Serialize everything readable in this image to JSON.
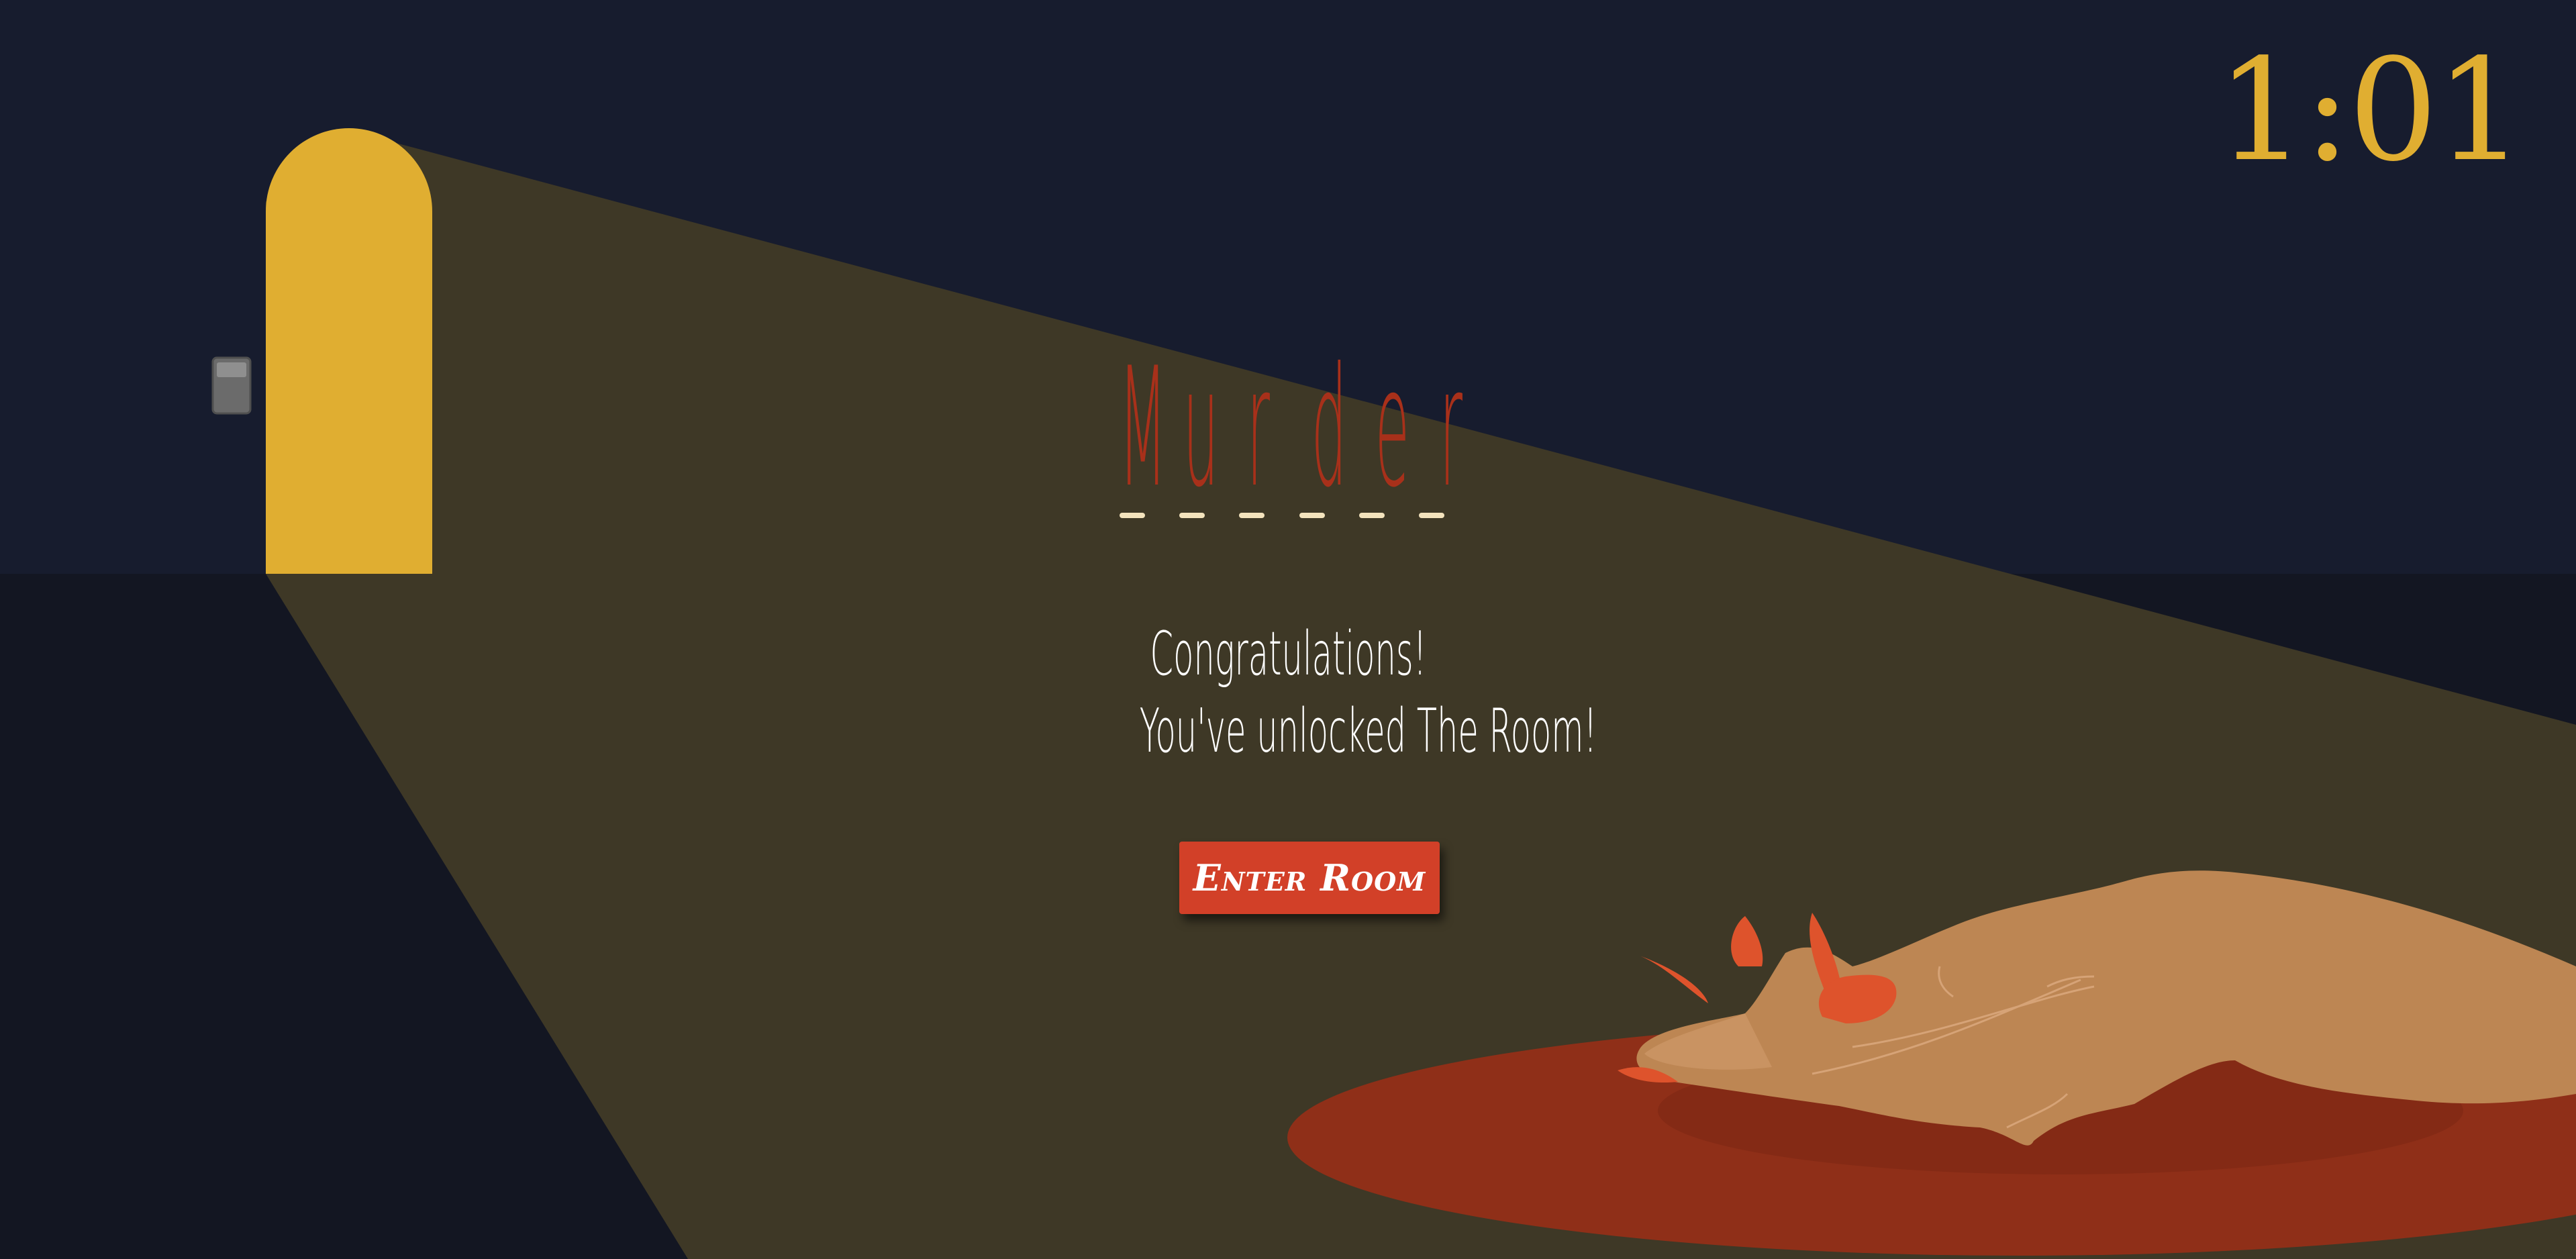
{
  "timer": {
    "text": "1:01",
    "color": "#e0ae31"
  },
  "puzzle": {
    "word": "Murder",
    "letters": [
      "M",
      "u",
      "r",
      "d",
      "e",
      "r"
    ],
    "letter_color": "#a8301a",
    "blank_count": 6
  },
  "message": {
    "line1": "Congratulations!",
    "line2": "You've unlocked The Room!"
  },
  "enter_button": {
    "label": "Enter Room",
    "color": "#d24028"
  },
  "scene": {
    "wall_color": "#171c2e",
    "floor_color": "#131622",
    "door_color": "#e0ae31",
    "light_color": "#3e3826",
    "blood_color": "#8f2f18",
    "skin_color": "#bd8653",
    "nail_color": "#de532c",
    "switch_color": "#6b6b6b",
    "icons": [
      "door-icon",
      "light-switch-icon",
      "hand-icon",
      "blood-pool-icon"
    ]
  }
}
